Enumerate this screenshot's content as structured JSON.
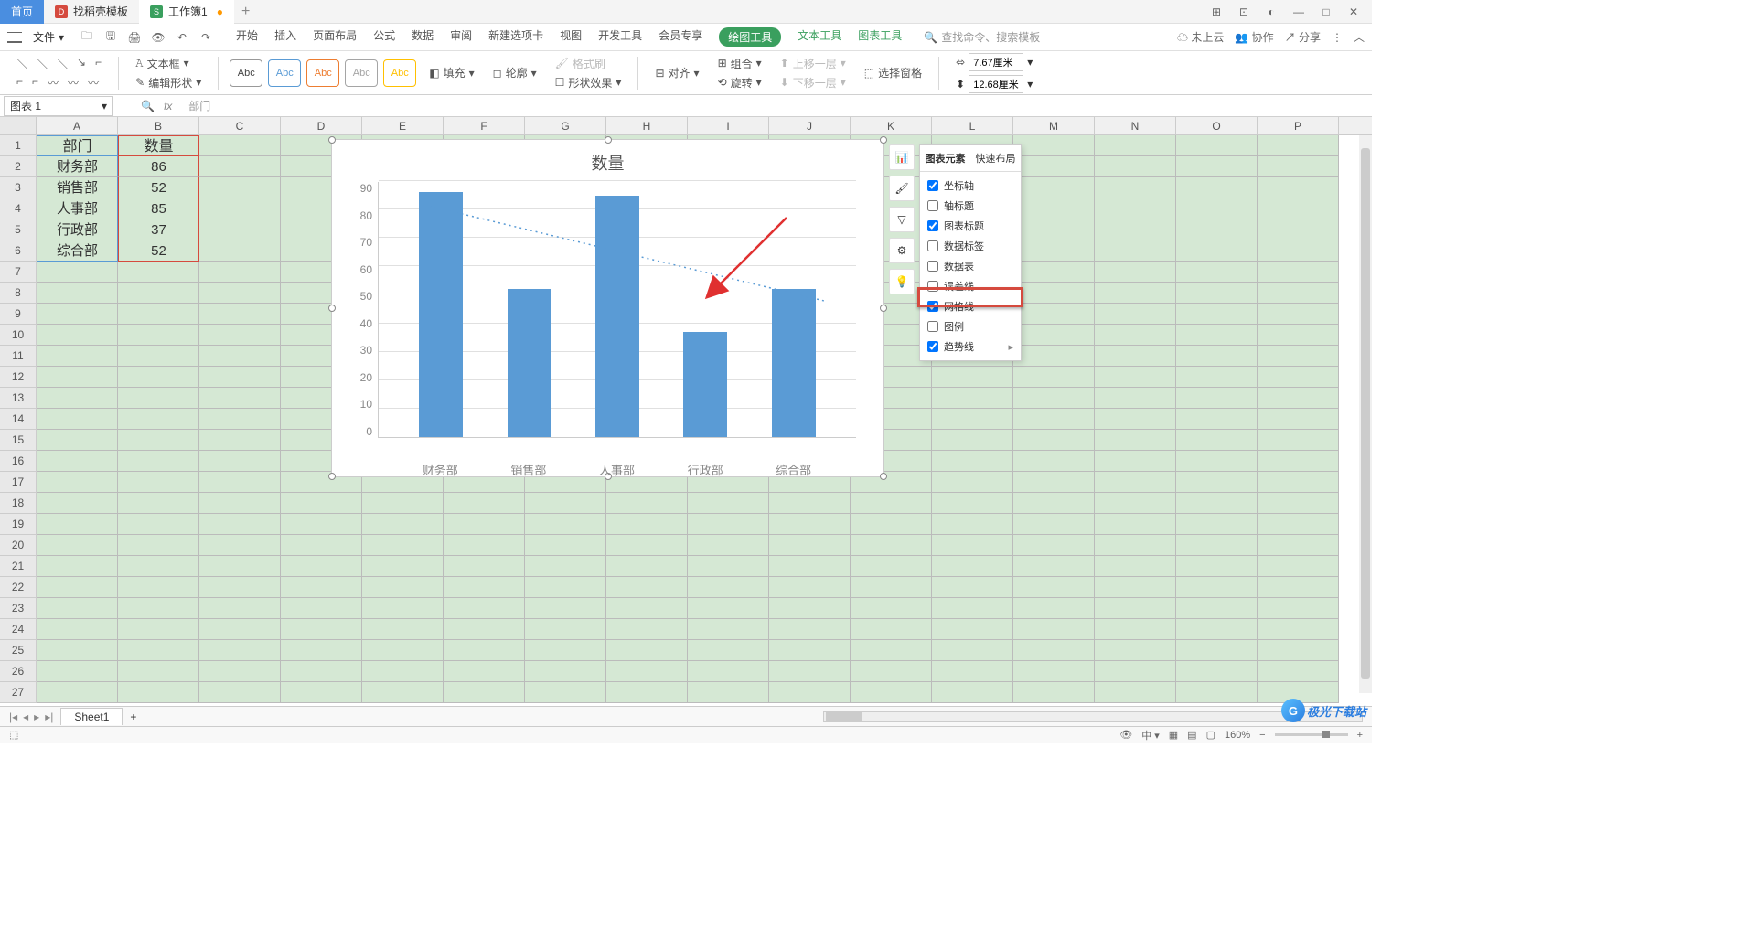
{
  "tabs": {
    "home": "首页",
    "template": "找稻壳模板",
    "workbook": "工作簿1"
  },
  "menu": {
    "file": "文件",
    "start": "开始",
    "insert": "插入",
    "layout": "页面布局",
    "formula": "公式",
    "data": "数据",
    "review": "审阅",
    "newtab": "新建选项卡",
    "view": "视图",
    "dev": "开发工具",
    "member": "会员专享",
    "drawing": "绘图工具",
    "text": "文本工具",
    "chart": "图表工具"
  },
  "search_placeholder": "查找命令、搜索模板",
  "cloud": "未上云",
  "collab": "协作",
  "share": "分享",
  "ribbon": {
    "textbox": "文本框",
    "editshape": "编辑形状",
    "abc": "Abc",
    "fill": "填充",
    "outline": "轮廓",
    "effect": "形状效果",
    "brush": "格式刷",
    "align": "对齐",
    "group": "组合",
    "rotate": "旋转",
    "up": "上移一层",
    "down": "下移一层",
    "pane": "选择窗格",
    "w": "7.67厘米",
    "h": "12.68厘米"
  },
  "namebox": "图表 1",
  "formula_text": "部门",
  "cols": [
    "A",
    "B",
    "C",
    "D",
    "E",
    "F",
    "G",
    "H",
    "I",
    "J",
    "K",
    "L",
    "M",
    "N",
    "O",
    "P"
  ],
  "rows": [
    "1",
    "2",
    "3",
    "4",
    "5",
    "6",
    "7",
    "8",
    "9",
    "10",
    "11",
    "12",
    "13",
    "14",
    "15",
    "16",
    "17",
    "18",
    "19",
    "20",
    "21",
    "22",
    "23",
    "24",
    "25",
    "26",
    "27"
  ],
  "table": {
    "headers": [
      "部门",
      "数量"
    ],
    "data": [
      [
        "财务部",
        "86"
      ],
      [
        "销售部",
        "52"
      ],
      [
        "人事部",
        "85"
      ],
      [
        "行政部",
        "37"
      ],
      [
        "综合部",
        "52"
      ]
    ]
  },
  "chart_data": {
    "type": "bar",
    "title": "数量",
    "categories": [
      "财务部",
      "销售部",
      "人事部",
      "行政部",
      "综合部"
    ],
    "values": [
      86,
      52,
      85,
      37,
      52
    ],
    "ylim": [
      0,
      90
    ],
    "yticks": [
      0,
      10,
      20,
      30,
      40,
      50,
      60,
      70,
      80,
      90
    ],
    "trendline": {
      "type": "linear",
      "style": "dotted",
      "color": "#5a9bd5"
    }
  },
  "side_icons": [
    "chart-options-icon",
    "brush-icon",
    "filter-icon",
    "settings-icon",
    "lightbulb-icon"
  ],
  "popup": {
    "tab1": "图表元素",
    "tab2": "快速布局",
    "items": [
      {
        "label": "坐标轴",
        "checked": true
      },
      {
        "label": "轴标题",
        "checked": false
      },
      {
        "label": "图表标题",
        "checked": true
      },
      {
        "label": "数据标签",
        "checked": false
      },
      {
        "label": "数据表",
        "checked": false
      },
      {
        "label": "误差线",
        "checked": false
      },
      {
        "label": "网格线",
        "checked": true
      },
      {
        "label": "图例",
        "checked": false
      },
      {
        "label": "趋势线",
        "checked": true,
        "highlight": true,
        "arrow": true
      }
    ]
  },
  "sheet": "Sheet1",
  "zoom": "160%",
  "watermark": "极光下载站"
}
